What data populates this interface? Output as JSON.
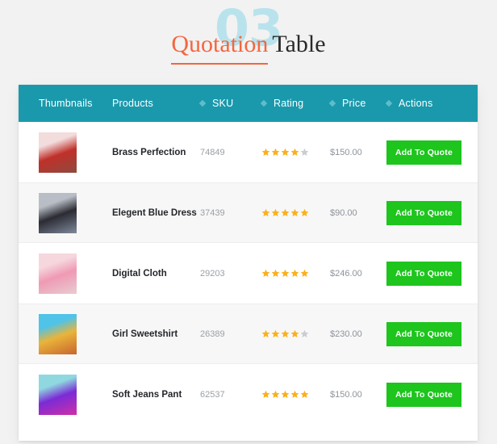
{
  "heading": {
    "watermark": "03",
    "accent_text": "Quotation",
    "rest_text": "Table",
    "accent_color": "#f4663f",
    "watermark_color": "#b9e3ec"
  },
  "table": {
    "header_color": "#1a99ac",
    "button_color": "#1dc51d",
    "star_on_color": "#fbb01c",
    "star_off_color": "#c9cdd1",
    "columns": [
      {
        "label": "Thumbnails",
        "sortable": false
      },
      {
        "label": "Products",
        "sortable": false
      },
      {
        "label": "SKU",
        "sortable": true
      },
      {
        "label": "Rating",
        "sortable": true
      },
      {
        "label": "Price",
        "sortable": true
      },
      {
        "label": "Actions",
        "sortable": true
      }
    ],
    "rows": [
      {
        "product": "Brass Perfection",
        "sku": "74849",
        "rating": 4,
        "rating_max": 5,
        "price": "$150.00",
        "action_label": "Add To Quote",
        "thumb_colors": [
          "#f2dcdc",
          "#c0302a",
          "#8e4a3e"
        ]
      },
      {
        "product": "Elegent Blue Dress",
        "sku": "37439",
        "rating": 5,
        "rating_max": 5,
        "price": "$90.00",
        "action_label": "Add To Quote",
        "thumb_colors": [
          "#b9bec6",
          "#2b2b33",
          "#7f8a9c"
        ]
      },
      {
        "product": "Digital Cloth",
        "sku": "29203",
        "rating": 5,
        "rating_max": 5,
        "price": "$246.00",
        "action_label": "Add To Quote",
        "thumb_colors": [
          "#f6d7de",
          "#ef9ab4",
          "#e8ccd2"
        ]
      },
      {
        "product": "Girl Sweetshirt",
        "sku": "26389",
        "rating": 4,
        "rating_max": 5,
        "price": "$230.00",
        "action_label": "Add To Quote",
        "thumb_colors": [
          "#4fc3e8",
          "#e9b43a",
          "#c8642f"
        ]
      },
      {
        "product": "Soft Jeans Pant",
        "sku": "62537",
        "rating": 5,
        "rating_max": 5,
        "price": "$150.00",
        "action_label": "Add To Quote",
        "thumb_colors": [
          "#8fd8e0",
          "#7b2bd6",
          "#d02fa8"
        ]
      }
    ]
  }
}
